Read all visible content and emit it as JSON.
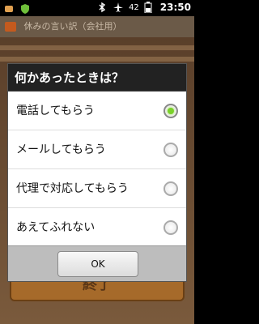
{
  "status_bar": {
    "battery": "42",
    "clock": "23:50",
    "icons": [
      "notification-icon",
      "shield-icon",
      "bluetooth-icon",
      "airplane-icon",
      "battery-icon"
    ]
  },
  "app": {
    "title": "休みの言い訳（会社用）",
    "end_button_label": "終了"
  },
  "dialog": {
    "title": "何かあったときは？",
    "options": [
      {
        "label": "電話してもらう",
        "selected": true
      },
      {
        "label": "メールしてもらう",
        "selected": false
      },
      {
        "label": "代理で対応してもらう",
        "selected": false
      },
      {
        "label": "あえてふれない",
        "selected": false
      }
    ],
    "ok_label": "OK"
  },
  "colors": {
    "accent_radio": "#7ad12a",
    "dialog_title_bg": "#222222"
  }
}
